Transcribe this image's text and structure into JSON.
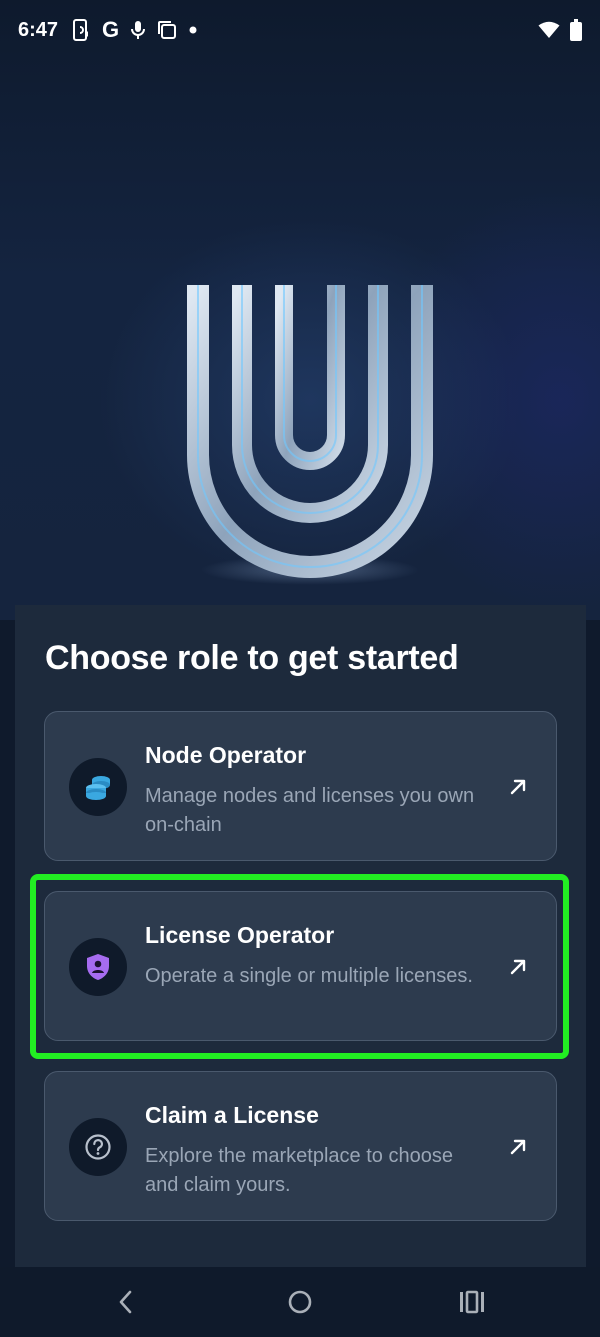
{
  "status_bar": {
    "time": "6:47",
    "icons_left": [
      "phone-sync-icon",
      "google-icon",
      "mic-icon",
      "copy-icon",
      "dot-icon"
    ],
    "icons_right": [
      "wifi-icon",
      "battery-icon"
    ]
  },
  "hero": {
    "logo": "u-logo"
  },
  "panel": {
    "title": "Choose role to get started",
    "cards": [
      {
        "title": "Node Operator",
        "description": "Manage nodes and licenses you own on-chain",
        "icon": "coin-stack-icon",
        "accent": "#3aa8e0"
      },
      {
        "title": "License Operator",
        "description": "Operate a single or multiple licenses.",
        "icon": "shield-user-icon",
        "accent": "#a66cf0"
      },
      {
        "title": "Claim a License",
        "description": "Explore the marketplace to choose and claim yours.",
        "icon": "question-circle-icon",
        "accent": "#b8c0cc"
      }
    ]
  },
  "highlight_color": "#22ee22",
  "nav_bar": {
    "buttons": [
      "back-icon",
      "home-icon",
      "recents-icon"
    ]
  }
}
